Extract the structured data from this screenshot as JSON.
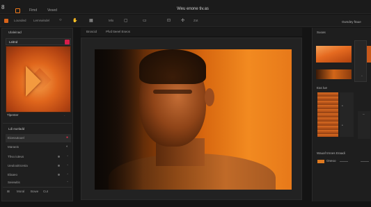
{
  "window": {
    "title": "Weu enone tiv.as",
    "app_glyph": "8"
  },
  "menu": [
    "Fimd",
    "Vesed"
  ],
  "toolbar": {
    "items": [
      "Lounded",
      "Lemrwindel",
      "Mlo",
      "Zot"
    ],
    "accent": "#d9641a"
  },
  "left_panel": {
    "header": "Ulaleinad",
    "preview_label": "Leitnd",
    "preview_caption": "Tlpenter",
    "layers_header": "Ldi eueladd",
    "layers": [
      {
        "label": "Eioeoutooel",
        "active": true
      },
      {
        "label": "Maraeis",
        "active": false
      },
      {
        "label": "Thvu iuteus",
        "active": false
      },
      {
        "label": "Ueulooitrcenia",
        "active": false
      },
      {
        "label": "Elaaeo",
        "active": false
      },
      {
        "label": "Seiewitis",
        "active": false
      }
    ],
    "footer": [
      "Moral",
      "Bowe",
      "Cut"
    ]
  },
  "center": {
    "tabs": [
      "Broscid",
      "Pfvd tteeel Eseos"
    ]
  },
  "right_panel": {
    "header": "Suoas",
    "corner_label": "Gwndey ftaue",
    "section2": "Eas lue",
    "section3": "Wauaf trnnes Eraadi",
    "pill_label": "Oneoo"
  },
  "colors": {
    "accent": "#f07a1a",
    "badge": "#d81d4a",
    "panel": "#1f1f1f",
    "background": "#141414"
  }
}
